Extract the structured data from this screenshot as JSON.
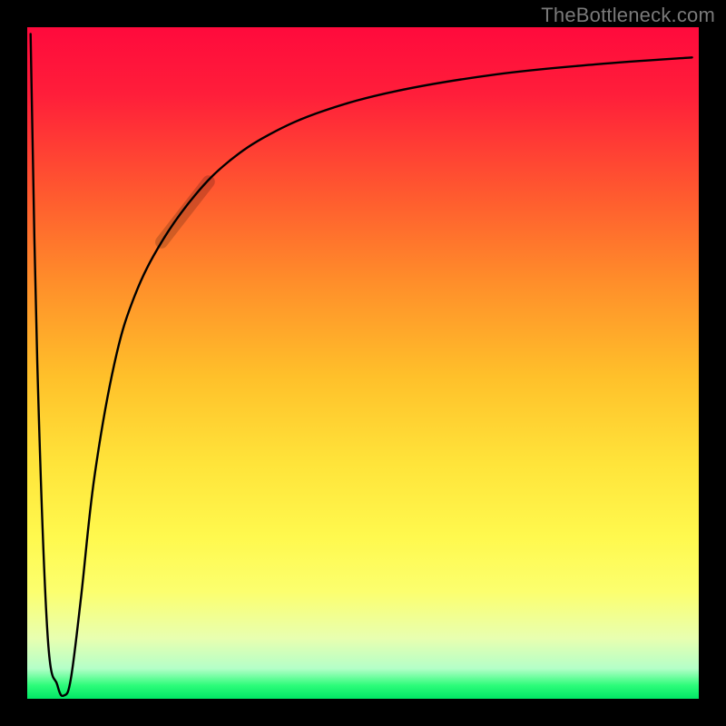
{
  "watermark": "TheBottleneck.com",
  "chart_data": {
    "type": "line",
    "title": "",
    "xlabel": "",
    "ylabel": "",
    "xlim": [
      0,
      100
    ],
    "ylim": [
      0,
      100
    ],
    "grid": false,
    "legend": false,
    "series": [
      {
        "name": "bottleneck-curve",
        "x": [
          0.5,
          1.5,
          3,
          4.5,
          5.5,
          6.5,
          8,
          10,
          13,
          16,
          20,
          25,
          30,
          36,
          44,
          55,
          70,
          85,
          99
        ],
        "y": [
          99,
          50,
          10,
          2,
          0.5,
          3,
          15,
          33,
          50,
          60,
          68,
          75,
          80,
          84,
          87.5,
          90.5,
          93,
          94.5,
          95.5
        ]
      },
      {
        "name": "highlight-segment",
        "x": [
          20,
          27
        ],
        "y": [
          68,
          77
        ]
      }
    ],
    "annotations": []
  }
}
